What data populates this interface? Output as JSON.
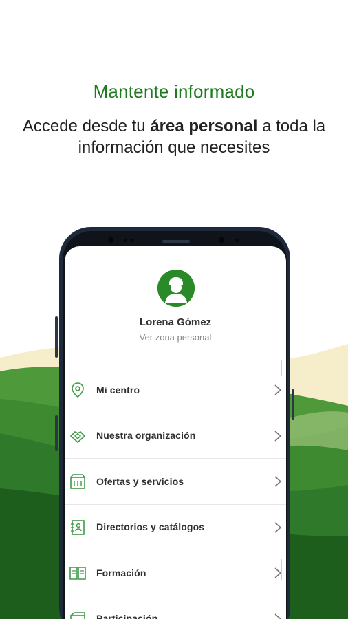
{
  "hero": {
    "title": "Mantente informado",
    "sub_before": "Accede desde tu ",
    "sub_bold": "área personal",
    "sub_after": " a toda la información que necesites"
  },
  "profile": {
    "name": "Lorena Gómez",
    "link": "Ver zona personal"
  },
  "menu": {
    "items": [
      {
        "label": "Mi centro",
        "icon": "location-pin-icon"
      },
      {
        "label": "Nuestra organización",
        "icon": "organization-icon"
      },
      {
        "label": "Ofertas y servicios",
        "icon": "offers-icon"
      },
      {
        "label": "Directorios y catálogos",
        "icon": "directory-icon"
      },
      {
        "label": "Formación",
        "icon": "book-icon"
      },
      {
        "label": "Participación",
        "icon": "participation-icon"
      }
    ]
  },
  "colors": {
    "brand_green": "#1e7a1e",
    "icon_green": "#3d9a46",
    "hill_dark": "#1d5e1d",
    "hill_mid": "#3e8a32",
    "hill_light": "#fbf3d6"
  }
}
